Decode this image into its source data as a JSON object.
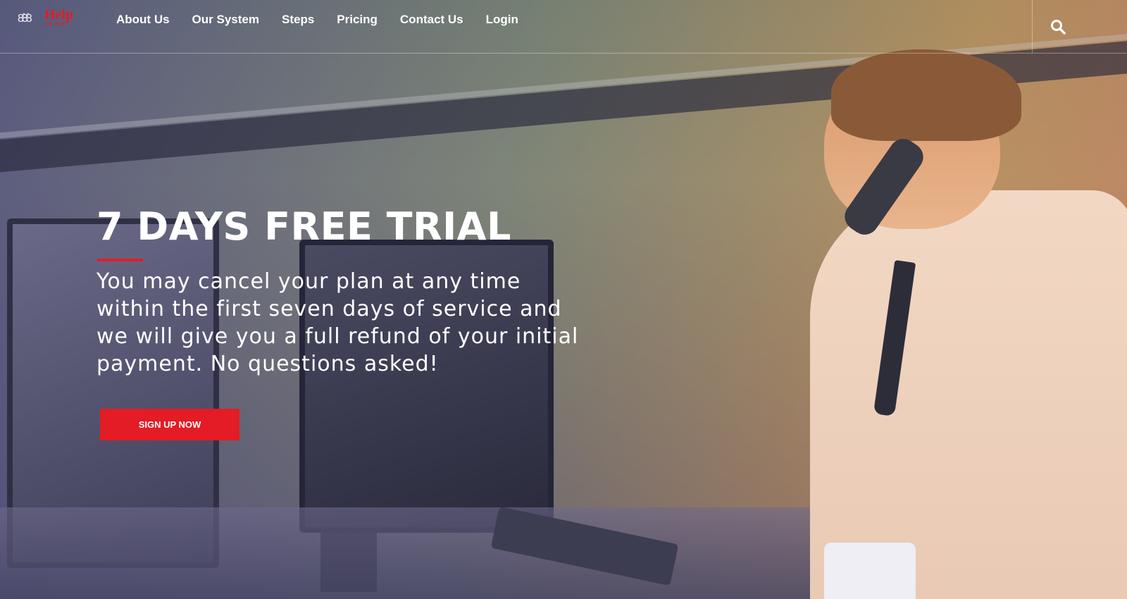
{
  "brand": {
    "logo_text": "Help",
    "logo_subtext": "call center",
    "logo_people_glyph": "8̊8̊8",
    "accent_color": "#e31c25"
  },
  "nav": {
    "items": [
      {
        "label": "About Us"
      },
      {
        "label": "Our System"
      },
      {
        "label": "Steps"
      },
      {
        "label": "Pricing"
      },
      {
        "label": "Contact Us"
      },
      {
        "label": "Login"
      }
    ],
    "search_icon": "search-icon"
  },
  "hero": {
    "headline": "7 DAYS FREE TRIAL",
    "description": "You may cancel your plan at any time within the first seven days of service and we will give you a full refund of your initial payment. No questions asked!",
    "cta_label": "SIGN UP NOW"
  }
}
